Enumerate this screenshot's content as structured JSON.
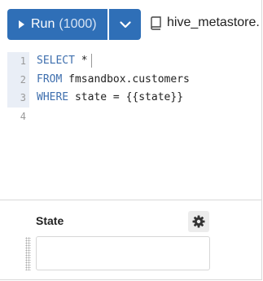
{
  "toolbar": {
    "run_label": "Run",
    "run_limit": "(1000)",
    "database": "hive_metastore."
  },
  "editor": {
    "line_numbers": [
      "1",
      "2",
      "3",
      "4"
    ],
    "lines": [
      {
        "keyword": "SELECT",
        "rest": " *"
      },
      {
        "keyword": "FROM",
        "rest": " fmsandbox.customers"
      },
      {
        "keyword": "WHERE",
        "rest": " state = {{state}}"
      },
      {
        "keyword": "",
        "rest": ""
      }
    ]
  },
  "parameters": {
    "state_label": "State",
    "state_value": ""
  },
  "icons": {
    "run": "play-icon",
    "dropdown": "chevron-down-icon",
    "database": "book-icon",
    "settings": "gear-icon",
    "drag": "drag-handle-icon"
  }
}
